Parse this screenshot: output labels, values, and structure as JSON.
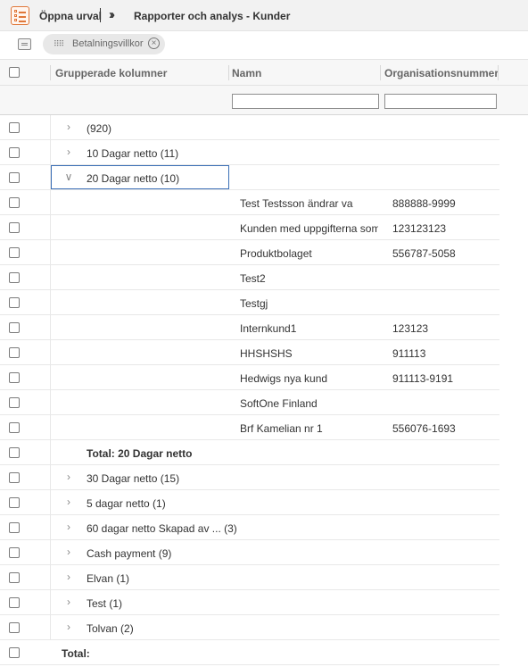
{
  "toolbar": {
    "open_selection": "Öppna urval",
    "breadcrumb": "Rapporter och analys - Kunder"
  },
  "grouping": {
    "chip_label": "Betalningsvillkor"
  },
  "columns": {
    "grouped": "Grupperade kolumner",
    "name": "Namn",
    "org_number": "Organisationsnummer"
  },
  "groups_before": [
    {
      "label": "(920)",
      "expanded": false
    },
    {
      "label": "10 Dagar netto (11)",
      "expanded": false
    },
    {
      "label": "20 Dagar netto (10)",
      "expanded": true
    }
  ],
  "customers": [
    {
      "name": "Test Testsson ändrar va",
      "org": "888888-9999"
    },
    {
      "name": "Kunden med uppgifterna som…",
      "org": "123123123"
    },
    {
      "name": "Produktbolaget",
      "org": "556787-5058"
    },
    {
      "name": "Test2",
      "org": ""
    },
    {
      "name": "Testgj",
      "org": ""
    },
    {
      "name": "Internkund1",
      "org": "123123"
    },
    {
      "name": "HHSHSHS",
      "org": "911113"
    },
    {
      "name": "Hedwigs nya kund",
      "org": "911113-9191"
    },
    {
      "name": "SoftOne Finland",
      "org": ""
    },
    {
      "name": "Brf Kamelian nr 1",
      "org": "556076-1693"
    }
  ],
  "group_total": "Total: 20 Dagar netto",
  "groups_after": [
    {
      "label": "30 Dagar netto (15)"
    },
    {
      "label": "5 dagar netto (1)"
    },
    {
      "label": "60 dagar netto Skapad av ...  (3)"
    },
    {
      "label": "Cash payment (9)"
    },
    {
      "label": "Elvan (1)"
    },
    {
      "label": "Test (1)"
    },
    {
      "label": "Tolvan (2)"
    }
  ],
  "grand_total": "Total:"
}
